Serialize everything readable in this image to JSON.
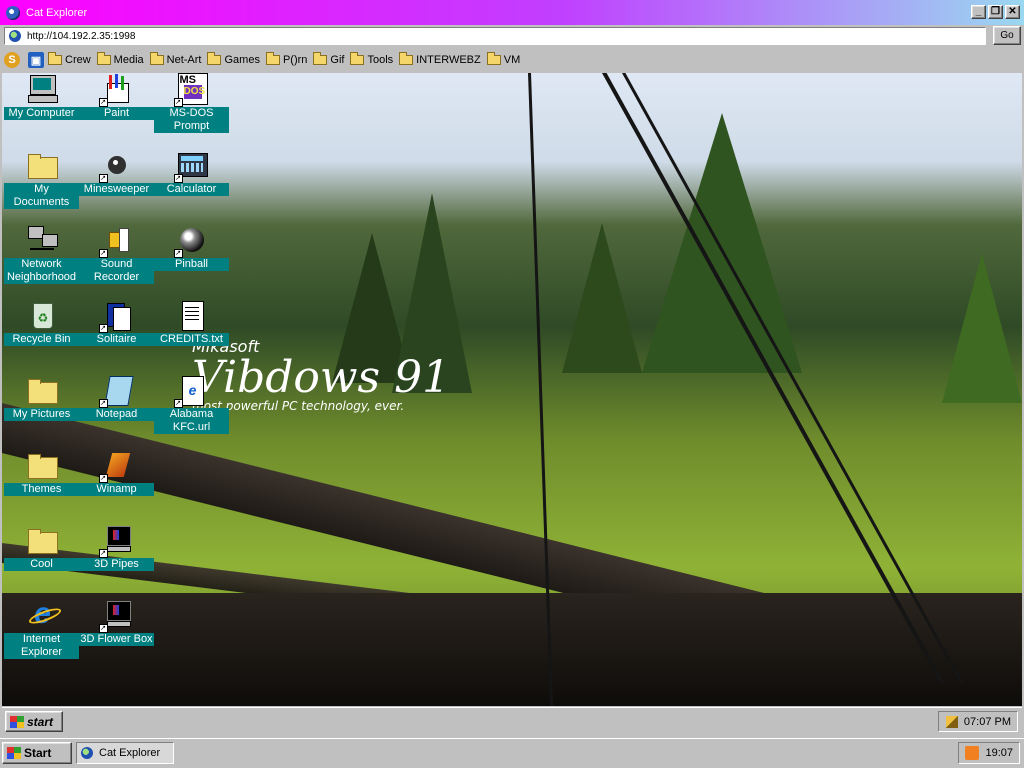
{
  "window": {
    "title": "Cat Explorer",
    "controls": {
      "minimize": "_",
      "restore": "❐",
      "close": "✕"
    }
  },
  "address_bar": {
    "url": "http://104.192.2.35:1998",
    "go_label": "Go"
  },
  "bookmarks": [
    {
      "label": "Crew"
    },
    {
      "label": "Media"
    },
    {
      "label": "Net-Art"
    },
    {
      "label": "Games"
    },
    {
      "label": "P()rn"
    },
    {
      "label": "Gif"
    },
    {
      "label": "Tools"
    },
    {
      "label": "INTERWEBZ"
    },
    {
      "label": "VM"
    }
  ],
  "desktop_icons": [
    {
      "label": "My Computer",
      "icon": "computer-icon"
    },
    {
      "label": "Paint",
      "icon": "paint-icon"
    },
    {
      "label": "MS-DOS Prompt",
      "icon": "msdos-icon"
    },
    {
      "label": "My Documents",
      "icon": "folder-documents-icon"
    },
    {
      "label": "Minesweeper",
      "icon": "minesweeper-icon"
    },
    {
      "label": "Calculator",
      "icon": "calculator-icon"
    },
    {
      "label": "Network Neighborhood",
      "icon": "network-icon"
    },
    {
      "label": "Sound Recorder",
      "icon": "sound-recorder-icon"
    },
    {
      "label": "Pinball",
      "icon": "pinball-icon"
    },
    {
      "label": "Recycle Bin",
      "icon": "recycle-bin-icon"
    },
    {
      "label": "Solitaire",
      "icon": "solitaire-icon"
    },
    {
      "label": "CREDITS.txt",
      "icon": "text-file-icon"
    },
    {
      "label": "My Pictures",
      "icon": "folder-icon"
    },
    {
      "label": "Notepad",
      "icon": "notepad-icon"
    },
    {
      "label": "Alabama KFC.url",
      "icon": "internet-shortcut-icon"
    },
    {
      "label": "Themes",
      "icon": "folder-icon"
    },
    {
      "label": "Winamp",
      "icon": "winamp-icon"
    },
    {
      "label": "Cool",
      "icon": "folder-icon"
    },
    {
      "label": "3D Pipes",
      "icon": "screensaver-icon"
    },
    {
      "label": "Internet Explorer",
      "icon": "ie-icon"
    },
    {
      "label": "3D Flower Box",
      "icon": "screensaver-icon"
    }
  ],
  "splash": {
    "brand": "Mikasoft",
    "product": "Vibdows 91",
    "tagline": "most powerful PC technology, ever."
  },
  "inner_taskbar": {
    "start_label": "start",
    "clock": "07:07 PM"
  },
  "outer_taskbar": {
    "start_label": "Start",
    "task_label": "Cat Explorer",
    "clock": "19:07"
  },
  "colors": {
    "title_gradient_start": "#ff00ff",
    "title_gradient_end": "#9ad8f0",
    "icon_label_bg": "#008080",
    "chrome": "#c0c0c0"
  }
}
